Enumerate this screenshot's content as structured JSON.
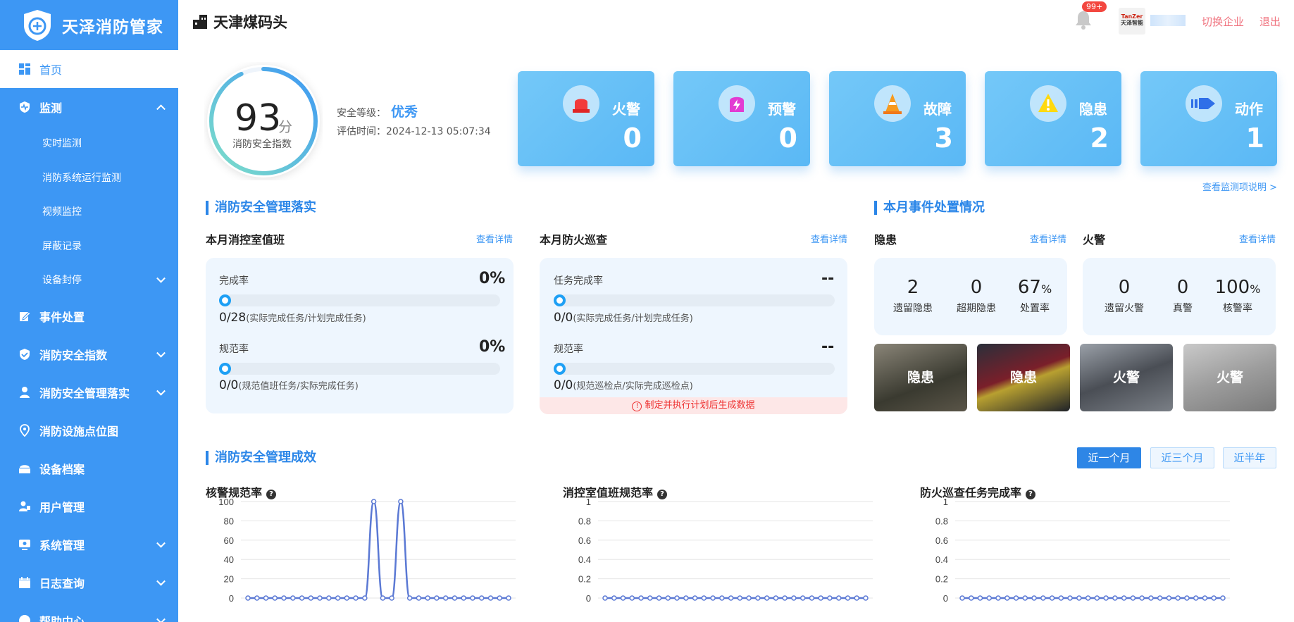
{
  "brand": {
    "title": "天泽消防管家"
  },
  "sidebar": {
    "home": "首页",
    "monitor": "监测",
    "monitor_subs": [
      "实时监测",
      "消防系统运行监测",
      "视频监控",
      "屏蔽记录",
      "设备封停"
    ],
    "items": [
      "事件处置",
      "消防安全指数",
      "消防安全管理落实",
      "消防设施点位图",
      "设备档案",
      "用户管理",
      "系统管理",
      "日志查询",
      "帮助中心"
    ]
  },
  "header": {
    "site": "天津煤码头",
    "badge": "99+",
    "logo_text": "TanZer",
    "logo_sub": "天泽智能",
    "switch": "切换企业",
    "logout": "退出"
  },
  "score": {
    "value": "93",
    "unit": "分",
    "label": "消防安全指数",
    "level_label": "安全等级：",
    "level": "优秀",
    "time_label": "评估时间：2024-12-13 05:07:34",
    "fraction": 0.93
  },
  "cards": [
    {
      "label": "火警",
      "value": "0",
      "icon": "siren-icon"
    },
    {
      "label": "预警",
      "value": "0",
      "icon": "lightning-icon"
    },
    {
      "label": "故障",
      "value": "3",
      "icon": "cone-icon"
    },
    {
      "label": "隐患",
      "value": "2",
      "icon": "warning-icon"
    },
    {
      "label": "动作",
      "value": "1",
      "icon": "arrow-icon"
    }
  ],
  "monitor_link": "查看监测项说明 >",
  "mgmt": {
    "title": "消防安全管理落实",
    "duty": {
      "title": "本月消控室值班",
      "link": "查看详情",
      "rate_label": "完成率",
      "rate": "0%",
      "rate_frac": "0/28",
      "rate_note": "(实际完成任务/计划完成任务)",
      "std_label": "规范率",
      "std": "0%",
      "std_frac": "0/0",
      "std_note": "(规范值班任务/实际完成任务)"
    },
    "patrol": {
      "title": "本月防火巡查",
      "link": "查看详情",
      "rate_label": "任务完成率",
      "rate": "--",
      "rate_frac": "0/0",
      "rate_note": "(实际完成任务/计划完成任务)",
      "std_label": "规范率",
      "std": "--",
      "std_frac": "0/0",
      "std_note": "(规范巡检点/实际完成巡检点)",
      "warn": "制定并执行计划后生成数据"
    }
  },
  "events": {
    "title": "本月事件处置情况",
    "hazard": {
      "title": "隐患",
      "link": "查看详情",
      "stats": [
        {
          "n": "2",
          "l": "遗留隐患"
        },
        {
          "n": "0",
          "l": "超期隐患"
        },
        {
          "n": "67",
          "unit": "%",
          "l": "处置率"
        }
      ]
    },
    "fire": {
      "title": "火警",
      "link": "查看详情",
      "stats": [
        {
          "n": "0",
          "l": "遗留火警"
        },
        {
          "n": "0",
          "l": "真警"
        },
        {
          "n": "100",
          "unit": "%",
          "l": "核警率"
        }
      ]
    },
    "thumbs": [
      "隐患",
      "隐患",
      "火警",
      "火警"
    ]
  },
  "effect": {
    "title": "消防安全管理成效",
    "ranges": [
      "近一个月",
      "近三个月",
      "近半年"
    ],
    "charts": [
      {
        "title": "核警规范率",
        "help": "?"
      },
      {
        "title": "消控室值班规范率",
        "help": "?"
      },
      {
        "title": "防火巡查任务完成率",
        "help": "?"
      }
    ]
  },
  "chart_data": [
    {
      "type": "line",
      "title": "核警规范率",
      "ylim": [
        0,
        100
      ],
      "yticks": [
        "100",
        "80",
        "60",
        "40",
        "20",
        "0"
      ],
      "points": 30,
      "series": [
        {
          "values": [
            0,
            0,
            0,
            0,
            0,
            0,
            0,
            0,
            0,
            0,
            0,
            0,
            0,
            0,
            100,
            0,
            0,
            100,
            0,
            0,
            0,
            0,
            0,
            0,
            0,
            0,
            0,
            0,
            0,
            0
          ]
        }
      ]
    },
    {
      "type": "line",
      "title": "消控室值班规范率",
      "ylim": [
        0,
        1
      ],
      "yticks": [
        "1",
        "0.8",
        "0.6",
        "0.4",
        "0.2",
        "0"
      ],
      "points": 30,
      "series": [
        {
          "values": [
            0,
            0,
            0,
            0,
            0,
            0,
            0,
            0,
            0,
            0,
            0,
            0,
            0,
            0,
            0,
            0,
            0,
            0,
            0,
            0,
            0,
            0,
            0,
            0,
            0,
            0,
            0,
            0,
            0,
            0
          ]
        }
      ]
    },
    {
      "type": "line",
      "title": "防火巡查任务完成率",
      "ylim": [
        0,
        1
      ],
      "yticks": [
        "1",
        "0.8",
        "0.6",
        "0.4",
        "0.2",
        "0"
      ],
      "points": 30,
      "series": [
        {
          "values": [
            0,
            0,
            0,
            0,
            0,
            0,
            0,
            0,
            0,
            0,
            0,
            0,
            0,
            0,
            0,
            0,
            0,
            0,
            0,
            0,
            0,
            0,
            0,
            0,
            0,
            0,
            0,
            0,
            0,
            0
          ]
        }
      ]
    }
  ],
  "colors": {
    "primary": "#3d97f4",
    "line": "#5b79d4",
    "danger": "#f3473f"
  }
}
